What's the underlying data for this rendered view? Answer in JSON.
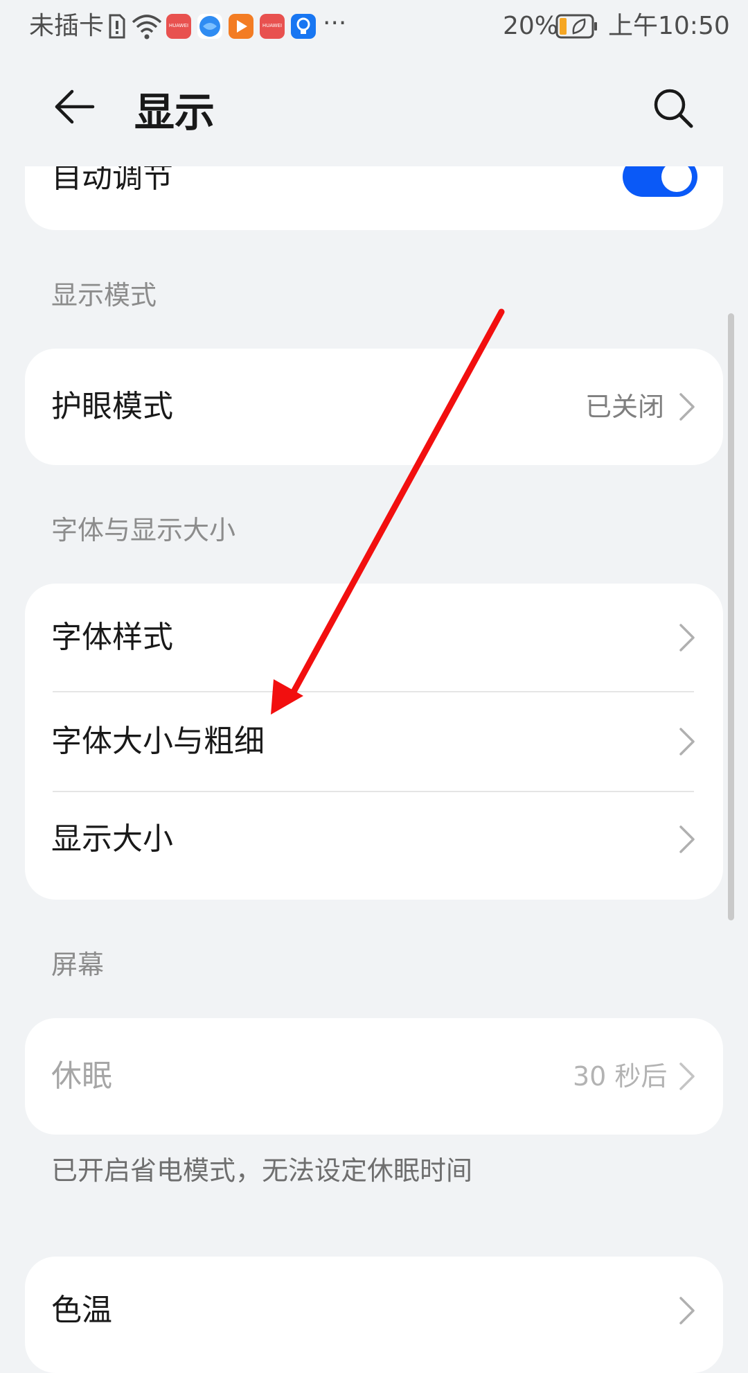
{
  "status_bar": {
    "carrier": "未插卡",
    "more": "···",
    "battery_percent": "20%",
    "time": "上午10:50",
    "app_icons": [
      {
        "name": "huawei-appgallery-icon",
        "color": "#e8514f",
        "label": "HUAWEI"
      },
      {
        "name": "browser-icon",
        "color": "#2f8cf2",
        "label": ""
      },
      {
        "name": "video-icon",
        "color": "#f37c23",
        "label": ""
      },
      {
        "name": "huawei-store-icon",
        "color": "#e8514f",
        "label": "HUAWEI"
      },
      {
        "name": "tips-icon",
        "color": "#1876f2",
        "label": ""
      }
    ]
  },
  "header": {
    "title": "显示"
  },
  "sections": {
    "auto_adjust": {
      "label": "自动调节",
      "toggle_on": true
    },
    "display_mode": {
      "title": "显示模式"
    },
    "eye_comfort": {
      "label": "护眼模式",
      "value": "已关闭"
    },
    "font_display": {
      "title": "字体与显示大小",
      "items": [
        {
          "label": "字体样式"
        },
        {
          "label": "字体大小与粗细"
        },
        {
          "label": "显示大小"
        }
      ]
    },
    "screen": {
      "title": "屏幕",
      "sleep": {
        "label": "休眠",
        "value": "30 秒后"
      },
      "hint": "已开启省电模式，无法设定休眠时间"
    },
    "color_temp": {
      "label": "色温"
    }
  },
  "colors": {
    "accent": "#0a59f7",
    "annotation_arrow": "#f20f0f",
    "background": "#f1f3f5"
  }
}
